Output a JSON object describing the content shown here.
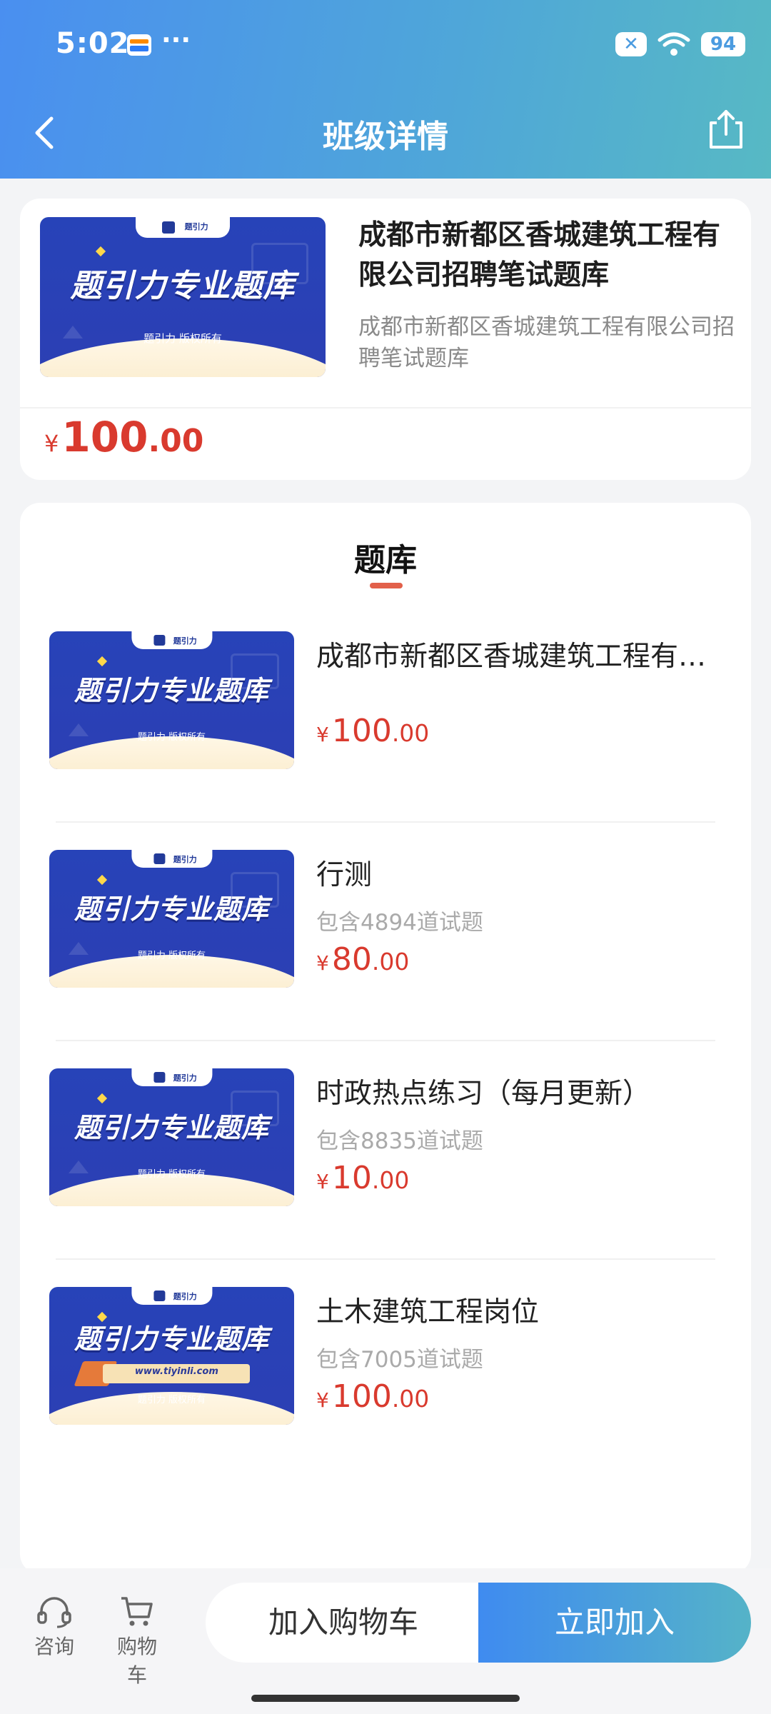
{
  "status_bar": {
    "time": "5:02",
    "dots": "···",
    "x_label": "✕",
    "battery": "94"
  },
  "header": {
    "title": "班级详情"
  },
  "banner": {
    "main_text": "题引力专业题库",
    "copyright": "题引力 版权所有",
    "tab_text": "题引力",
    "url": "www.tiyinli.com"
  },
  "course": {
    "title": "成都市新都区香城建筑工程有限公司招聘笔试题库",
    "subtitle": "成都市新都区香城建筑工程有限公司招聘笔试题库",
    "price": {
      "currency": "¥",
      "integer": "100",
      "decimal": ".00"
    }
  },
  "section": {
    "title": "题库"
  },
  "items": [
    {
      "name": "成都市新都区香城建筑工程有限公司招聘笔试题库",
      "count": "",
      "price": {
        "currency": "¥",
        "integer": "100",
        "decimal": ".00"
      }
    },
    {
      "name": "行测",
      "count": "包含4894道试题",
      "price": {
        "currency": "¥",
        "integer": "80",
        "decimal": ".00"
      }
    },
    {
      "name": "时政热点练习（每月更新）",
      "count": "包含8835道试题",
      "price": {
        "currency": "¥",
        "integer": "10",
        "decimal": ".00"
      }
    },
    {
      "name": "土木建筑工程岗位",
      "count": "包含7005道试题",
      "price": {
        "currency": "¥",
        "integer": "100",
        "decimal": ".00"
      }
    }
  ],
  "bottom_bar": {
    "consult_label": "咨询",
    "cart_label": "购物车",
    "add_to_cart": "加入购物车",
    "join_now": "立即加入"
  },
  "colors": {
    "accent_blue": "#4a8ff0",
    "price_red": "#d93a2e",
    "tab_underline": "#e2604a"
  }
}
